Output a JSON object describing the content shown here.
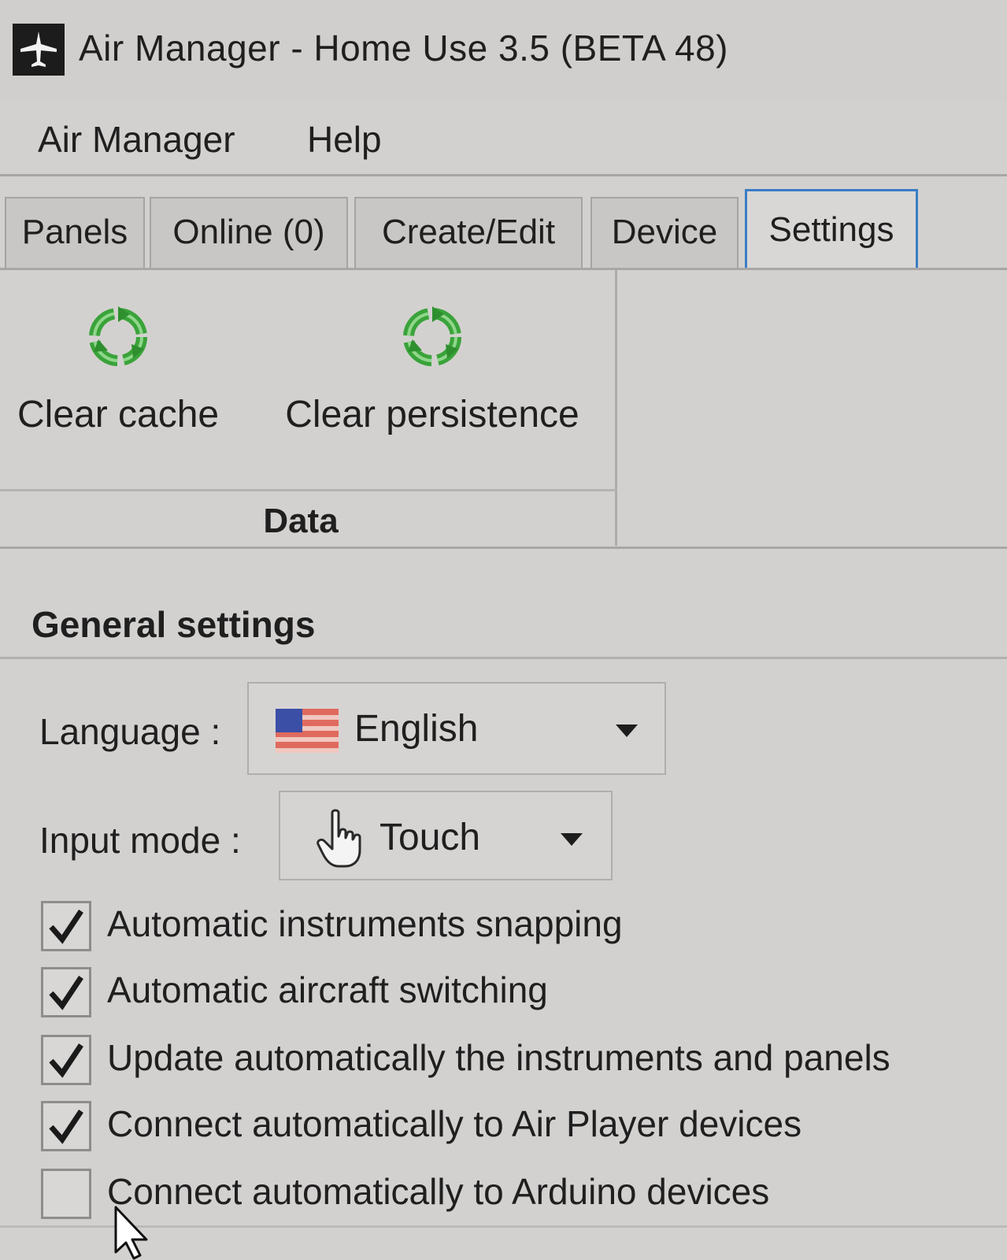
{
  "window": {
    "title": "Air Manager - Home Use 3.5 (BETA 48)",
    "icon": "airplane-icon"
  },
  "menu": {
    "items": [
      "Air Manager",
      "Help"
    ]
  },
  "tabs": [
    {
      "label": "Panels",
      "active": false
    },
    {
      "label": "Online (0)",
      "active": false
    },
    {
      "label": "Create/Edit",
      "active": false
    },
    {
      "label": "Device",
      "active": false
    },
    {
      "label": "Settings",
      "active": true
    }
  ],
  "ribbon": {
    "group_label": "Data",
    "buttons": [
      {
        "label": "Clear cache",
        "icon": "recycle-icon"
      },
      {
        "label": "Clear persistence",
        "icon": "recycle-icon"
      }
    ]
  },
  "general": {
    "title": "General settings",
    "language": {
      "label": "Language :",
      "value": "English",
      "icon": "us-flag-icon"
    },
    "input_mode": {
      "label": "Input mode :",
      "value": "Touch",
      "icon": "hand-pointer-icon"
    },
    "options": [
      {
        "label": "Automatic instruments snapping",
        "checked": true
      },
      {
        "label": "Automatic aircraft switching",
        "checked": true
      },
      {
        "label": "Update automatically the instruments and panels",
        "checked": true
      },
      {
        "label": "Connect automatically to Air Player devices",
        "checked": true
      },
      {
        "label": "Connect automatically to Arduino devices",
        "checked": false
      }
    ]
  },
  "colors": {
    "active_tab_border": "#3a7cc4",
    "recycle_green": "#3aa33a",
    "checkmark": "#1a1a1a"
  }
}
